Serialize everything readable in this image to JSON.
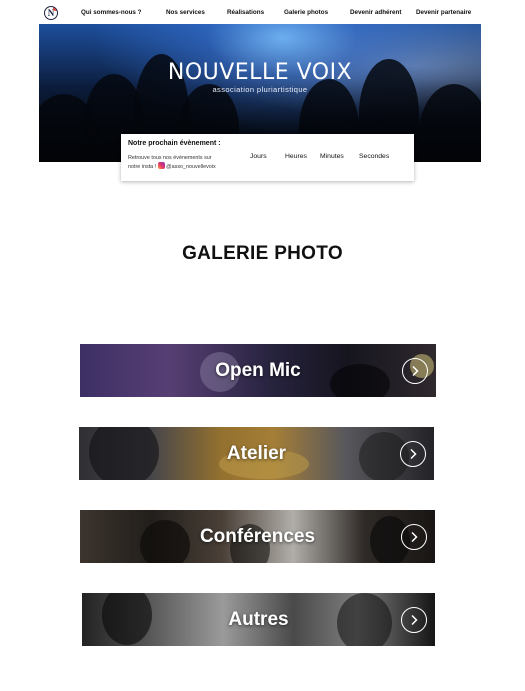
{
  "nav": {
    "logo_letter": "N",
    "links": [
      "Qui sommes-nous ?",
      "Nos services",
      "Réalisations",
      "Galerie photos",
      "Devenir adhérent",
      "Devenir partenaire"
    ]
  },
  "hero": {
    "title": "NOUVELLE VOIX",
    "subtitle": "association pluriartistique"
  },
  "event": {
    "title": "Notre prochain évènement :",
    "text_line1": "Retrouve tous nos évènements sur",
    "text_line2_prefix": "notre insta !",
    "insta_handle": "@asso_nouvellevoix",
    "countdown_labels": [
      "Jours",
      "Heures",
      "Minutes",
      "Secondes"
    ]
  },
  "heading": "GALERIE PHOTO",
  "gallery": [
    {
      "label": "Open Mic",
      "arrow_icon": "chevron-right-icon"
    },
    {
      "label": "Atelier",
      "arrow_icon": "chevron-right-icon"
    },
    {
      "label": "Conférences",
      "arrow_icon": "chevron-right-icon"
    },
    {
      "label": "Autres",
      "arrow_icon": "chevron-right-icon"
    }
  ],
  "colors": {
    "accent_red": "#e0473b",
    "logo_navy": "#1c2340",
    "hero_blue": "#1d4f9c"
  }
}
